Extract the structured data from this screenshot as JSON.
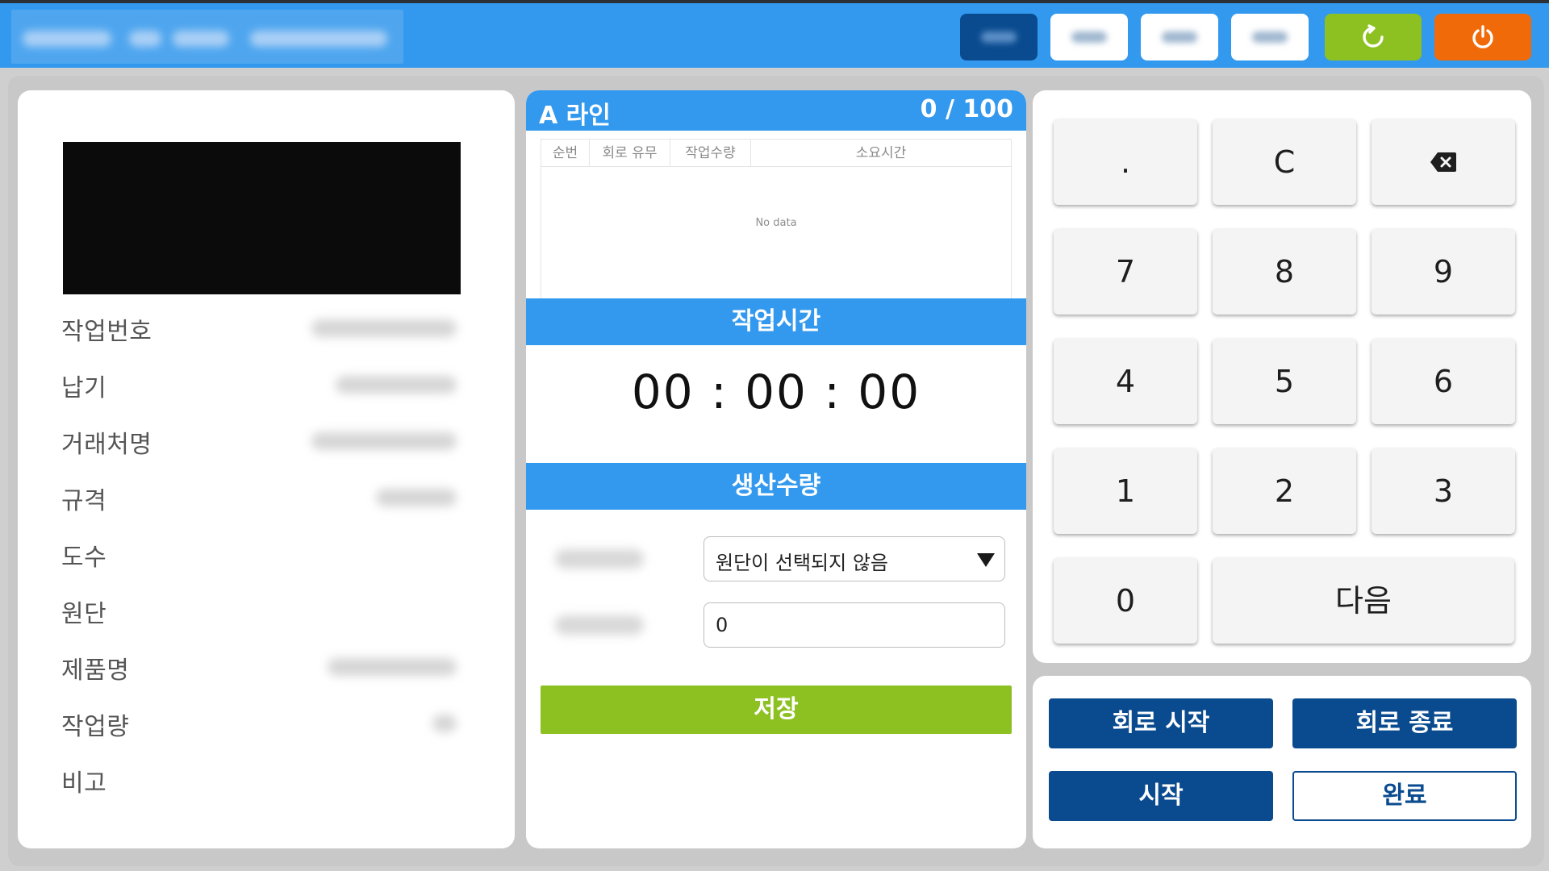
{
  "colors": {
    "header": "#3399ee",
    "navy": "#0a4b8f",
    "green": "#8dc121",
    "orange": "#f06a09"
  },
  "header": {
    "buttons": [
      {
        "style": "dark"
      },
      {
        "style": "white"
      },
      {
        "style": "white"
      },
      {
        "style": "white"
      },
      {
        "icon": "refresh-icon",
        "style": "green"
      },
      {
        "icon": "power-icon",
        "style": "orange"
      }
    ]
  },
  "info": {
    "labels": [
      "작업번호",
      "납기",
      "거래처명",
      "규격",
      "도수",
      "원단",
      "제품명",
      "작업량",
      "비고"
    ]
  },
  "line": {
    "name": "A 라인",
    "count": "0 / 100",
    "table": {
      "columns": [
        "순번",
        "회로 유무",
        "작업수량",
        "소요시간"
      ],
      "empty_text": "No data"
    },
    "work_time_label": "작업시간",
    "timer": "00 : 00 : 00",
    "production_label": "생산수량",
    "fabric_select_value": "원단이 선택되지 않음",
    "quantity_value": "0",
    "save_label": "저장"
  },
  "keypad": {
    "keys": [
      ".",
      "C",
      "backspace-icon",
      "7",
      "8",
      "9",
      "4",
      "5",
      "6",
      "1",
      "2",
      "3",
      "0",
      "다음"
    ],
    "dot": ".",
    "clear": "C",
    "k7": "7",
    "k8": "8",
    "k9": "9",
    "k4": "4",
    "k5": "5",
    "k6": "6",
    "k1": "1",
    "k2": "2",
    "k3": "3",
    "k0": "0",
    "next": "다음"
  },
  "controls": {
    "circuit_start": "회로 시작",
    "circuit_end": "회로 종료",
    "start": "시작",
    "complete": "완료"
  }
}
